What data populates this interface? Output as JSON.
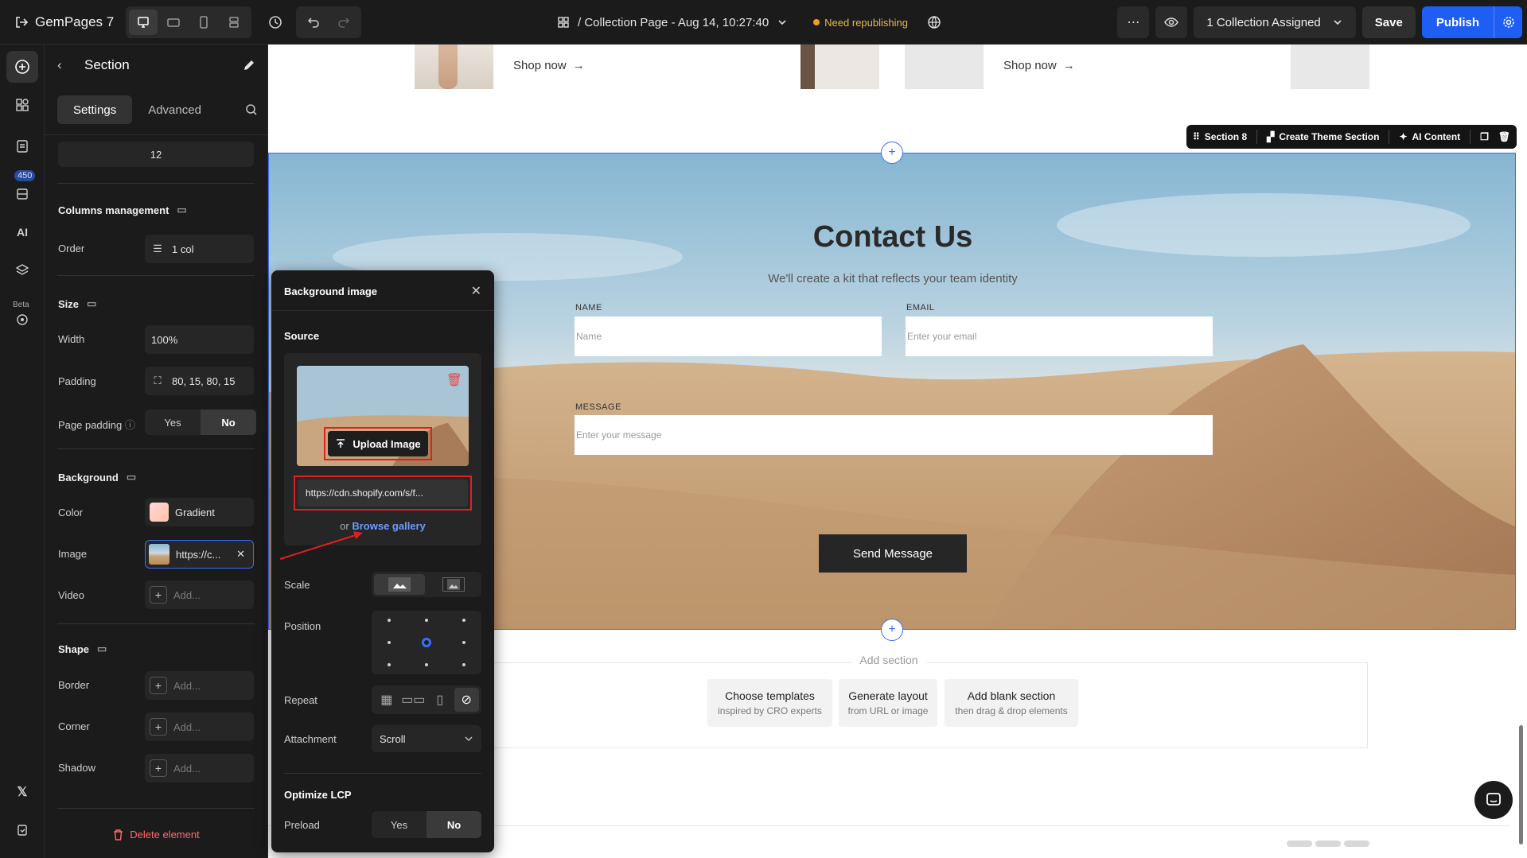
{
  "app": {
    "name": "GemPages 7"
  },
  "header": {
    "page_title": "/ Collection Page - Aug 14, 10:27:40",
    "republish_badge": "Need republishing",
    "assign_label": "1 Collection Assigned",
    "save_label": "Save",
    "publish_label": "Publish"
  },
  "rail": {
    "badge_count": "450",
    "ai_label": "AI",
    "beta_label": "Beta"
  },
  "panel": {
    "title": "Section",
    "tabs": [
      {
        "label": "Settings"
      },
      {
        "label": "Advanced"
      }
    ],
    "top_value": "12",
    "columns": {
      "title": "Columns management",
      "order_label": "Order",
      "order_value": "1 col"
    },
    "size": {
      "title": "Size",
      "width_label": "Width",
      "width_value": "100%",
      "padding_label": "Padding",
      "padding_value": "80, 15, 80, 15",
      "page_padding_label": "Page padding",
      "yes": "Yes",
      "no": "No"
    },
    "background": {
      "title": "Background",
      "color_label": "Color",
      "color_value": "Gradient",
      "image_label": "Image",
      "image_value": "https://c...",
      "video_label": "Video",
      "add": "Add..."
    },
    "shape": {
      "title": "Shape",
      "border_label": "Border",
      "corner_label": "Corner",
      "shadow_label": "Shadow",
      "add": "Add..."
    },
    "delete_label": "Delete element"
  },
  "canvas": {
    "shop_now": "Shop now",
    "section_toolbar": {
      "section": "Section 8",
      "create_theme": "Create Theme Section",
      "ai_content": "AI Content"
    },
    "contact": {
      "title": "Contact Us",
      "subtitle": "We'll create a kit that reflects your team identity",
      "name_label": "NAME",
      "name_placeholder": "Name",
      "email_label": "EMAIL",
      "email_placeholder": "Enter your email",
      "message_label": "MESSAGE",
      "message_placeholder": "Enter your message",
      "send_label": "Send Message"
    },
    "add_section": {
      "title": "Add section",
      "options": [
        {
          "title": "Choose templates",
          "sub": "inspired by CRO experts"
        },
        {
          "title": "Generate layout",
          "sub": "from URL or image"
        },
        {
          "title": "Add blank section",
          "sub": "then drag & drop elements"
        }
      ]
    }
  },
  "popover": {
    "title": "Background image",
    "source_label": "Source",
    "upload_label": "Upload Image",
    "url_value": "https://cdn.shopify.com/s/f...",
    "or_text": "or",
    "browse_label": "Browse gallery",
    "scale_label": "Scale",
    "position_label": "Position",
    "repeat_label": "Repeat",
    "attachment_label": "Attachment",
    "attachment_value": "Scroll",
    "lcp_title": "Optimize LCP",
    "preload_label": "Preload",
    "yes": "Yes",
    "no": "No"
  },
  "colors": {
    "accent": "#1f5ef5",
    "highlight": "#e01f1f",
    "panel_bg": "#1b1b1b"
  }
}
